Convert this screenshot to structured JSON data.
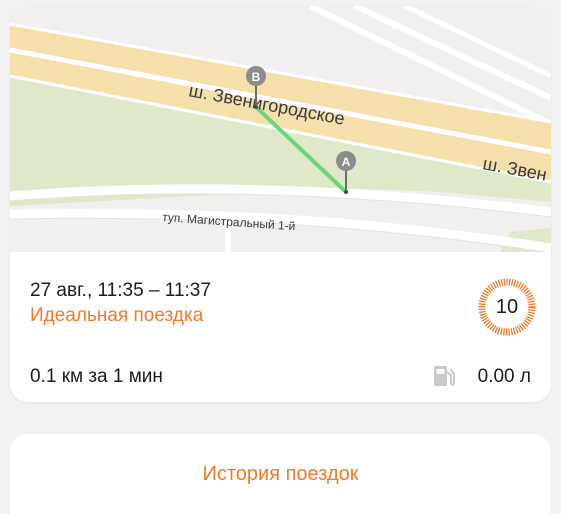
{
  "trip": {
    "map": {
      "street_main_1": "ш. Звенигородское",
      "street_main_2": "ш. Звен",
      "street_side": "туп. Магистральный 1-й",
      "marker_start": "A",
      "marker_end": "B",
      "route_color": "#6cd67c"
    },
    "time_range": "27 авг., 11:35 – 11:37",
    "status": "Идеальная поездка",
    "score": "10",
    "distance": "0.1 км за 1 мин",
    "fuel": "0.00 л",
    "fuel_icon": "fuel-pump-icon"
  },
  "history_button": "История поездок",
  "colors": {
    "accent": "#f07a2a",
    "background": "#f2f2f2",
    "card": "#ffffff"
  }
}
